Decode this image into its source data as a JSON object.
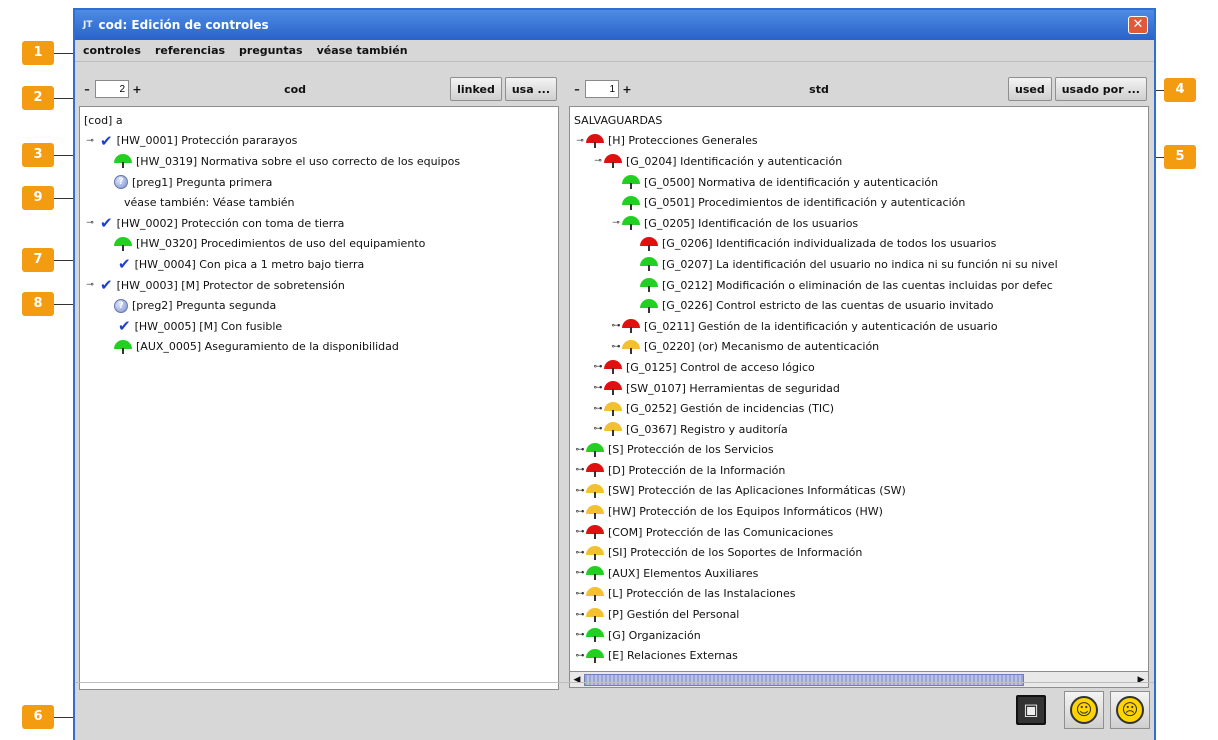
{
  "window": {
    "title": "cod: Edición de controles",
    "app_icon": "JT"
  },
  "menu": [
    "controles",
    "referencias",
    "preguntas",
    "véase también"
  ],
  "left": {
    "stepper_value": "2",
    "title": "cod",
    "buttons": [
      "linked",
      "usa ..."
    ],
    "rows": [
      {
        "indent": 0,
        "toggle": "",
        "icon": "",
        "text": "[cod] a"
      },
      {
        "indent": 0,
        "toggle": "⊸",
        "icon": "check",
        "text": "[HW_0001] Protección pararayos"
      },
      {
        "indent": 1,
        "toggle": "",
        "icon": "green",
        "text": "[HW_0319] Normativa sobre el uso correcto de los equipos"
      },
      {
        "indent": 1,
        "toggle": "",
        "icon": "question",
        "text": "[preg1] Pregunta primera"
      },
      {
        "indent": 1,
        "toggle": "",
        "icon": "",
        "text": "véase también: Véase también"
      },
      {
        "indent": 0,
        "toggle": "⊸",
        "icon": "check",
        "text": "[HW_0002] Protección con toma de tierra"
      },
      {
        "indent": 1,
        "toggle": "",
        "icon": "green",
        "text": "[HW_0320] Procedimientos de uso del equipamiento"
      },
      {
        "indent": 1,
        "toggle": "",
        "icon": "check",
        "text": "[HW_0004] Con pica a 1 metro bajo tierra"
      },
      {
        "indent": 0,
        "toggle": "⊸",
        "icon": "check",
        "text": "[HW_0003] [M] Protector de sobretensión"
      },
      {
        "indent": 1,
        "toggle": "",
        "icon": "question",
        "text": "[preg2] Pregunta segunda"
      },
      {
        "indent": 1,
        "toggle": "",
        "icon": "check",
        "text": "[HW_0005] [M] Con fusible"
      },
      {
        "indent": 1,
        "toggle": "",
        "icon": "green",
        "text": "[AUX_0005] Aseguramiento de la disponibilidad"
      }
    ]
  },
  "right": {
    "stepper_value": "1",
    "title": "std",
    "buttons": [
      "used",
      "usado por ..."
    ],
    "rows": [
      {
        "indent": 0,
        "toggle": "",
        "icon": "",
        "text": "SALVAGUARDAS"
      },
      {
        "indent": 0,
        "toggle": "⊸",
        "icon": "red",
        "text": "[H] Protecciones Generales"
      },
      {
        "indent": 1,
        "toggle": "⊸",
        "icon": "red",
        "text": "[G_0204] Identificación y autenticación"
      },
      {
        "indent": 2,
        "toggle": "",
        "icon": "green",
        "text": "[G_0500] Normativa de identificación y autenticación"
      },
      {
        "indent": 2,
        "toggle": "",
        "icon": "green",
        "text": "[G_0501] Procedimientos de identificación y autenticación"
      },
      {
        "indent": 2,
        "toggle": "⊸",
        "icon": "green",
        "text": "[G_0205] Identificación de los usuarios"
      },
      {
        "indent": 3,
        "toggle": "",
        "icon": "red",
        "text": "[G_0206] Identificación individualizada de todos los usuarios"
      },
      {
        "indent": 3,
        "toggle": "",
        "icon": "green",
        "text": "[G_0207] La identificación del usuario no indica ni su función ni su nivel"
      },
      {
        "indent": 3,
        "toggle": "",
        "icon": "green",
        "text": "[G_0212] Modificación o eliminación de las cuentas incluidas por defec"
      },
      {
        "indent": 3,
        "toggle": "",
        "icon": "green",
        "text": "[G_0226] Control estricto de las cuentas de usuario invitado"
      },
      {
        "indent": 2,
        "toggle": "⊶",
        "icon": "red",
        "text": "[G_0211] Gestión de la identificación y autenticación de usuario"
      },
      {
        "indent": 2,
        "toggle": "⊶",
        "icon": "yellow",
        "text": "[G_0220] (or) Mecanismo de autenticación"
      },
      {
        "indent": 1,
        "toggle": "⊶",
        "icon": "red",
        "text": "[G_0125] Control de acceso lógico"
      },
      {
        "indent": 1,
        "toggle": "⊶",
        "icon": "red",
        "text": "[SW_0107] Herramientas de seguridad"
      },
      {
        "indent": 1,
        "toggle": "⊶",
        "icon": "yellow",
        "text": "[G_0252] Gestión de incidencias (TIC)"
      },
      {
        "indent": 1,
        "toggle": "⊶",
        "icon": "yellow",
        "text": "[G_0367] Registro y auditoría"
      },
      {
        "indent": 0,
        "toggle": "⊶",
        "icon": "green",
        "text": "[S] Protección de los Servicios"
      },
      {
        "indent": 0,
        "toggle": "⊶",
        "icon": "red",
        "text": "[D] Protección de la Información"
      },
      {
        "indent": 0,
        "toggle": "⊶",
        "icon": "yellow",
        "text": "[SW] Protección de las Aplicaciones Informáticas (SW)"
      },
      {
        "indent": 0,
        "toggle": "⊶",
        "icon": "yellow",
        "text": "[HW] Protección de los Equipos Informáticos (HW)"
      },
      {
        "indent": 0,
        "toggle": "⊶",
        "icon": "red",
        "text": "[COM] Protección de las Comunicaciones"
      },
      {
        "indent": 0,
        "toggle": "⊶",
        "icon": "yellow",
        "text": "[SI] Protección de los Soportes de Información"
      },
      {
        "indent": 0,
        "toggle": "⊶",
        "icon": "green",
        "text": "[AUX] Elementos Auxiliares"
      },
      {
        "indent": 0,
        "toggle": "⊶",
        "icon": "yellow",
        "text": "[L] Protección de las Instalaciones"
      },
      {
        "indent": 0,
        "toggle": "⊶",
        "icon": "yellow",
        "text": "[P] Gestión del Personal"
      },
      {
        "indent": 0,
        "toggle": "⊶",
        "icon": "green",
        "text": "[G] Organización"
      },
      {
        "indent": 0,
        "toggle": "⊶",
        "icon": "green",
        "text": "[E] Relaciones Externas"
      }
    ]
  },
  "status": {
    "save_icon": "floppy-disk-icon",
    "happy_icon": "smiley-happy-icon",
    "sad_icon": "smiley-sad-icon"
  },
  "callouts": [
    "1",
    "2",
    "3",
    "9",
    "7",
    "8",
    "6",
    "4",
    "5"
  ],
  "colors": {
    "red": "#e01010",
    "green": "#22d022",
    "yellow": "#f3c030",
    "accent": "#2f6fd0",
    "callout": "#f39c12"
  }
}
